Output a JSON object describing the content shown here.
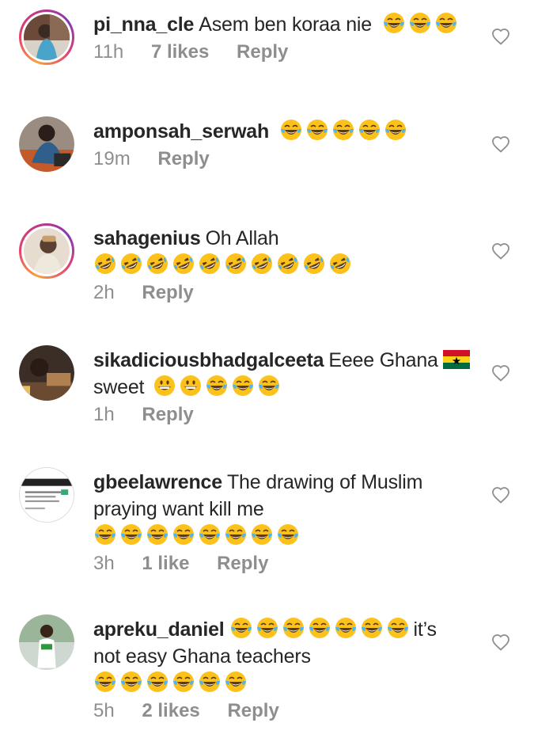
{
  "comments": [
    {
      "username": "pi_nna_cle",
      "text": "Asem ben koraa nie",
      "emojis": [
        "tears-of-joy",
        "tears-of-joy",
        "tears-of-joy"
      ],
      "time": "11h",
      "likes": "7 likes",
      "reply": "Reply",
      "avatar_icon": "user-avatar-icon"
    },
    {
      "username": "amponsah_serwah",
      "text": "",
      "emojis": [
        "tears-of-joy",
        "tears-of-joy",
        "tears-of-joy",
        "tears-of-joy",
        "tears-of-joy"
      ],
      "time": "19m",
      "likes": "",
      "reply": "Reply",
      "avatar_icon": "user-avatar-icon"
    },
    {
      "username": "sahagenius",
      "text": "Oh Allah",
      "emojis": [
        "rofl",
        "rofl",
        "rofl",
        "rofl",
        "rofl",
        "rofl",
        "rofl",
        "rofl",
        "rofl",
        "rofl"
      ],
      "time": "2h",
      "likes": "",
      "reply": "Reply",
      "avatar_icon": "user-avatar-icon"
    },
    {
      "username": "sikadiciousbhadgalceeta",
      "text": "Eeee Ghana",
      "text2": "sweet",
      "flag": "ghana-flag-icon",
      "emojis": [
        "grinning",
        "grinning",
        "tears-of-joy",
        "tears-of-joy",
        "tears-of-joy"
      ],
      "time": "1h",
      "likes": "",
      "reply": "Reply",
      "avatar_icon": "user-avatar-icon"
    },
    {
      "username": "gbeelawrence",
      "text": "The drawing of Muslim",
      "text2": "praying want kill me",
      "emojis": [
        "tears-of-joy",
        "tears-of-joy",
        "tears-of-joy",
        "tears-of-joy",
        "tears-of-joy",
        "tears-of-joy",
        "tears-of-joy",
        "tears-of-joy"
      ],
      "time": "3h",
      "likes": "1 like",
      "reply": "Reply",
      "avatar_icon": "user-avatar-icon"
    },
    {
      "username": "apreku_daniel",
      "text": "it’s",
      "text2": "not easy Ghana teachers",
      "emojis_inline": [
        "tears-of-joy",
        "tears-of-joy",
        "tears-of-joy",
        "tears-of-joy",
        "tears-of-joy",
        "tears-of-joy",
        "tears-of-joy"
      ],
      "emojis": [
        "tears-of-joy",
        "tears-of-joy",
        "tears-of-joy",
        "tears-of-joy",
        "tears-of-joy",
        "tears-of-joy"
      ],
      "time": "5h",
      "likes": "2 likes",
      "reply": "Reply",
      "avatar_icon": "user-avatar-icon"
    }
  ],
  "colors": {
    "text": "#262626",
    "meta": "#8e8e8e",
    "emoji_face": "#fcc21b"
  }
}
